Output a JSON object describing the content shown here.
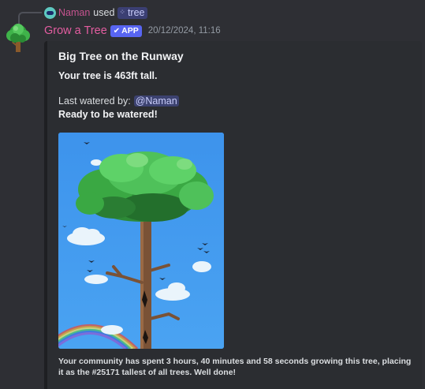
{
  "reply": {
    "username": "Naman",
    "used_text": "used",
    "command_icon": "slash-command-icon",
    "command_name": "tree"
  },
  "message": {
    "avatar_icon": "tree-avatar-icon",
    "username": "Grow a Tree",
    "app_tag": "APP",
    "app_tag_icon": "verified-check-icon",
    "timestamp": "20/12/2024, 11:16",
    "colors": {
      "username": "#e35da0",
      "app_tag": "#5865f2",
      "mention_bg": "#3c4270"
    }
  },
  "embed": {
    "title": "Big Tree on the Runway",
    "height_text": "Your tree is 463ft tall.",
    "last_watered_label": "Last watered by:",
    "last_watered_mention": "@Naman",
    "status_text": "Ready to be watered!",
    "image_icon": "tree-illustration",
    "footer_text": "Your community has spent 3 hours, 40 minutes and 58 seconds growing this tree, placing it as the #25171 tallest of all trees. Well done!"
  }
}
